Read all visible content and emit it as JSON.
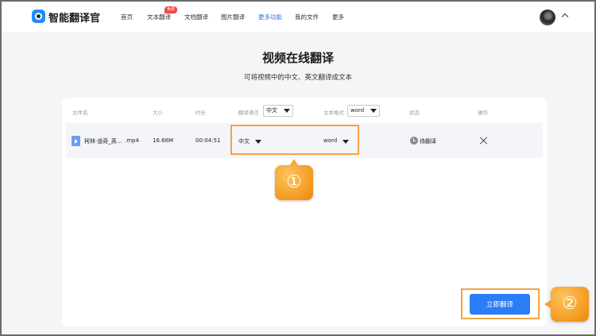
{
  "app": {
    "name": "智能翻译官"
  },
  "nav": {
    "items": [
      {
        "label": "首页"
      },
      {
        "label": "文本翻译",
        "badge": "免费"
      },
      {
        "label": "文档翻译"
      },
      {
        "label": "图片翻译"
      },
      {
        "label": "更多功能",
        "active": true
      },
      {
        "label": "我的文件"
      },
      {
        "label": "更多"
      }
    ]
  },
  "page": {
    "title": "视频在线翻译",
    "subtitle": "可将视频中的中文、英文翻译成文本"
  },
  "table": {
    "headers": {
      "file_name": "文件名",
      "size": "大小",
      "duration": "时长",
      "language": "翻译语言",
      "format": "文本格式",
      "status": "状态",
      "action": "操作"
    },
    "header_language_value": "中文",
    "header_format_value": "word",
    "rows": [
      {
        "file_name": "柯林·道奇_英…",
        "file_ext": ".mp4",
        "size": "16.66M",
        "duration": "00:04:51",
        "language": "中文",
        "format": "word",
        "status": "待翻译"
      }
    ]
  },
  "callouts": {
    "one": "①",
    "two": "②"
  },
  "actions": {
    "translate_label": "立即翻译"
  },
  "colors": {
    "accent": "#2a7df6",
    "highlight": "#f3a245",
    "badge": "#f24646"
  }
}
